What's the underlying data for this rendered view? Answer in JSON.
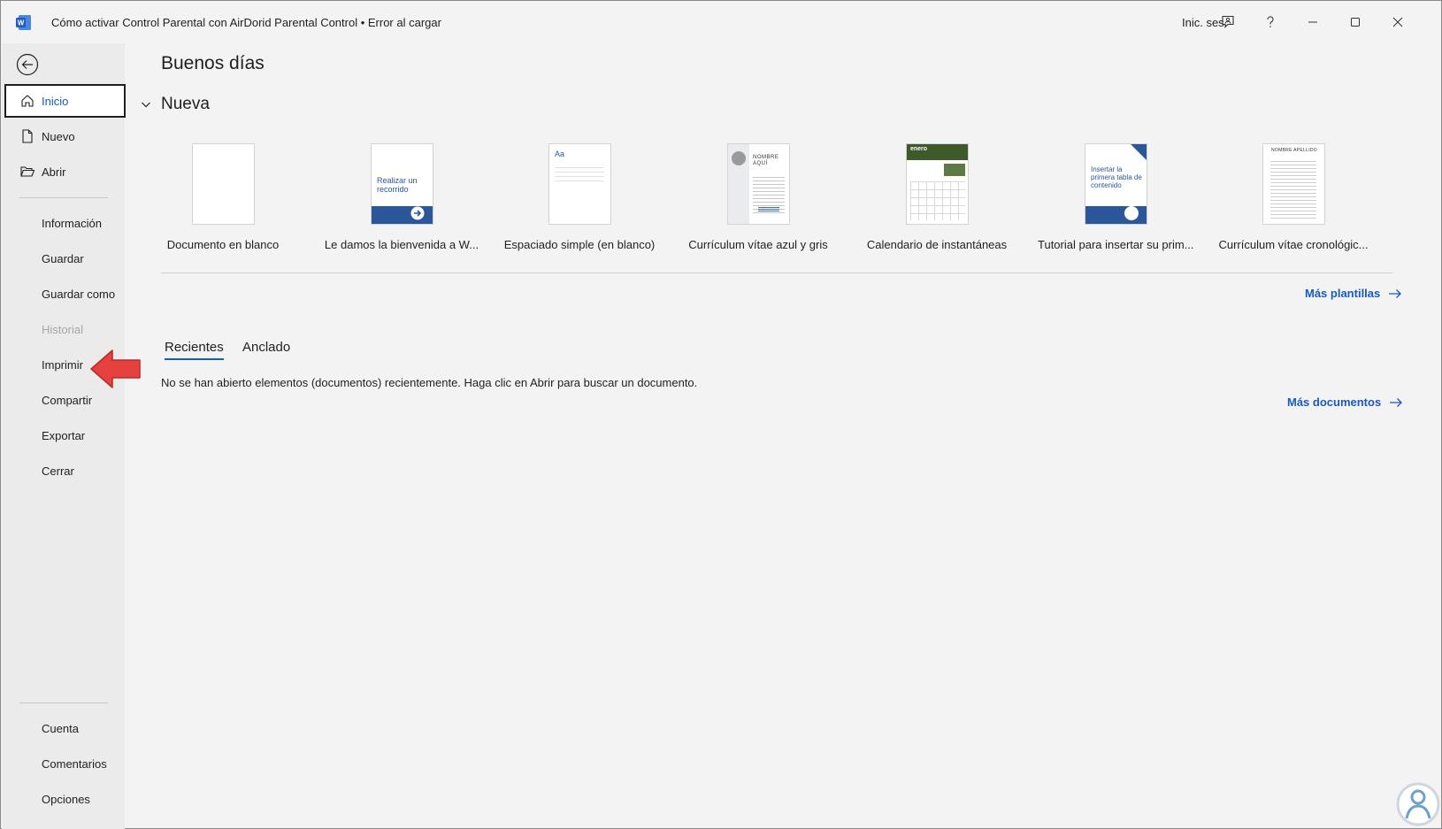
{
  "window": {
    "app": "Word",
    "title": "Cómo activar Control Parental con AirDorid Parental Control • Error al cargar",
    "signin_label": "Inic. ses."
  },
  "sidebar": {
    "items": [
      {
        "label": "Inicio",
        "icon": "home-icon"
      },
      {
        "label": "Nuevo",
        "icon": "new-document-icon"
      },
      {
        "label": "Abrir",
        "icon": "folder-open-icon"
      },
      {
        "label": "Información"
      },
      {
        "label": "Guardar"
      },
      {
        "label": "Guardar como"
      },
      {
        "label": "Historial"
      },
      {
        "label": "Imprimir"
      },
      {
        "label": "Compartir"
      },
      {
        "label": "Exportar"
      },
      {
        "label": "Cerrar"
      }
    ],
    "bottom_items": [
      {
        "label": "Cuenta"
      },
      {
        "label": "Comentarios"
      },
      {
        "label": "Opciones"
      }
    ]
  },
  "main": {
    "greeting": "Buenos días",
    "new_section_title": "Nueva",
    "templates": [
      {
        "label": "Documento en blanco"
      },
      {
        "label": "Le damos la bienvenida a W...",
        "thumb_text": "Realizar un recorrido"
      },
      {
        "label": "Espaciado simple (en blanco)",
        "thumb_text": "Aa"
      },
      {
        "label": "Currículum vítae azul y gris",
        "thumb_text": "NOMBRE AQUÍ"
      },
      {
        "label": "Calendario de instantáneas",
        "thumb_text": "enero"
      },
      {
        "label": "Tutorial para insertar su prim...",
        "thumb_text": "Insertar la primera tabla de contenido"
      },
      {
        "label": "Currículum vítae cronológic...",
        "thumb_text": "NOMBRE APELLIDO"
      }
    ],
    "more_templates_label": "Más plantillas",
    "tabs": [
      {
        "label": "Recientes",
        "active": true
      },
      {
        "label": "Anclado",
        "active": false
      }
    ],
    "empty_message": "No se han abierto elementos (documentos) recientemente. Haga clic en Abrir para buscar un documento.",
    "more_documents_label": "Más documentos"
  },
  "colors": {
    "accent": "#185abd",
    "background": "#f3f3f3",
    "sidebar": "#ebebeb",
    "annotation_arrow": "#e5413f"
  }
}
